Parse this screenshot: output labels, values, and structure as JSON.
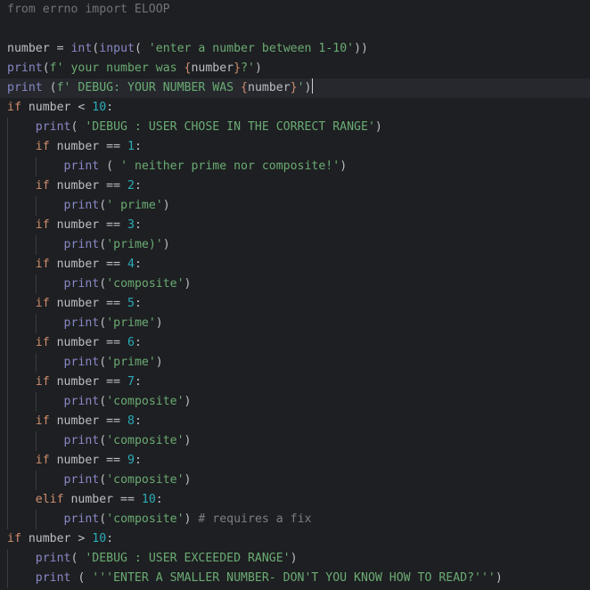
{
  "colors": {
    "background": "#1e1f22",
    "current_line": "#26282e",
    "keyword": "#cf8e6d",
    "builtin": "#8888c6",
    "string": "#6aab73",
    "number": "#2aacb8",
    "comment": "#7a7e85",
    "identifier": "#bcbec4"
  },
  "code_lines": [
    {
      "indent": 0,
      "tokens": [
        [
          "unused",
          "from errno import ELOOP"
        ]
      ]
    },
    {
      "indent": 0,
      "tokens": []
    },
    {
      "indent": 0,
      "tokens": [
        [
          "id",
          "number"
        ],
        [
          "p",
          " = "
        ],
        [
          "bi",
          "int"
        ],
        [
          "p",
          "("
        ],
        [
          "bi",
          "input"
        ],
        [
          "p",
          "( "
        ],
        [
          "str",
          "'enter a number between 1-10'"
        ],
        [
          "p",
          "))"
        ]
      ]
    },
    {
      "indent": 0,
      "tokens": [
        [
          "bi",
          "print"
        ],
        [
          "p",
          "("
        ],
        [
          "str",
          "f' your number was "
        ],
        [
          "brace",
          "{"
        ],
        [
          "id",
          "number"
        ],
        [
          "brace",
          "}"
        ],
        [
          "str",
          "?'"
        ],
        [
          "p",
          ")"
        ]
      ]
    },
    {
      "indent": 0,
      "current": true,
      "caret": true,
      "tokens": [
        [
          "bi",
          "print"
        ],
        [
          "p",
          " "
        ],
        [
          "p",
          "("
        ],
        [
          "str",
          "f' DEBUG: YOUR NUMBER WAS "
        ],
        [
          "brace",
          "{"
        ],
        [
          "id",
          "number"
        ],
        [
          "brace",
          "}"
        ],
        [
          "str",
          "'"
        ],
        [
          "p",
          ")"
        ]
      ]
    },
    {
      "indent": 0,
      "tokens": [
        [
          "kw",
          "if"
        ],
        [
          "p",
          " number < "
        ],
        [
          "num",
          "10"
        ],
        [
          "p",
          ":"
        ]
      ]
    },
    {
      "indent": 1,
      "tokens": [
        [
          "bi",
          "print"
        ],
        [
          "p",
          "( "
        ],
        [
          "str",
          "'DEBUG : USER CHOSE IN THE CORRECT RANGE'"
        ],
        [
          "p",
          ")"
        ]
      ]
    },
    {
      "indent": 1,
      "tokens": [
        [
          "kw",
          "if"
        ],
        [
          "p",
          " number == "
        ],
        [
          "num",
          "1"
        ],
        [
          "p",
          ":"
        ]
      ]
    },
    {
      "indent": 2,
      "tokens": [
        [
          "bi",
          "print"
        ],
        [
          "p",
          " ( "
        ],
        [
          "str",
          "' neither prime nor composite!'"
        ],
        [
          "p",
          ")"
        ]
      ]
    },
    {
      "indent": 1,
      "tokens": [
        [
          "kw",
          "if"
        ],
        [
          "p",
          " number == "
        ],
        [
          "num",
          "2"
        ],
        [
          "p",
          ":"
        ]
      ]
    },
    {
      "indent": 2,
      "tokens": [
        [
          "bi",
          "print"
        ],
        [
          "p",
          "("
        ],
        [
          "str",
          "' prime'"
        ],
        [
          "p",
          ")"
        ]
      ]
    },
    {
      "indent": 1,
      "tokens": [
        [
          "kw",
          "if"
        ],
        [
          "p",
          " number == "
        ],
        [
          "num",
          "3"
        ],
        [
          "p",
          ":"
        ]
      ]
    },
    {
      "indent": 2,
      "tokens": [
        [
          "bi",
          "print"
        ],
        [
          "p",
          "("
        ],
        [
          "str",
          "'prime)'"
        ],
        [
          "p",
          ")"
        ]
      ]
    },
    {
      "indent": 1,
      "tokens": [
        [
          "kw",
          "if"
        ],
        [
          "p",
          " number == "
        ],
        [
          "num",
          "4"
        ],
        [
          "p",
          ":"
        ]
      ]
    },
    {
      "indent": 2,
      "tokens": [
        [
          "bi",
          "print"
        ],
        [
          "p",
          "("
        ],
        [
          "str",
          "'composite'"
        ],
        [
          "p",
          ")"
        ]
      ]
    },
    {
      "indent": 1,
      "tokens": [
        [
          "kw",
          "if"
        ],
        [
          "p",
          " number == "
        ],
        [
          "num",
          "5"
        ],
        [
          "p",
          ":"
        ]
      ]
    },
    {
      "indent": 2,
      "tokens": [
        [
          "bi",
          "print"
        ],
        [
          "p",
          "("
        ],
        [
          "str",
          "'prime'"
        ],
        [
          "p",
          ")"
        ]
      ]
    },
    {
      "indent": 1,
      "tokens": [
        [
          "kw",
          "if"
        ],
        [
          "p",
          " number == "
        ],
        [
          "num",
          "6"
        ],
        [
          "p",
          ":"
        ]
      ]
    },
    {
      "indent": 2,
      "tokens": [
        [
          "bi",
          "print"
        ],
        [
          "p",
          "("
        ],
        [
          "str",
          "'prime'"
        ],
        [
          "p",
          ")"
        ]
      ]
    },
    {
      "indent": 1,
      "tokens": [
        [
          "kw",
          "if"
        ],
        [
          "p",
          " number == "
        ],
        [
          "num",
          "7"
        ],
        [
          "p",
          ":"
        ]
      ]
    },
    {
      "indent": 2,
      "tokens": [
        [
          "bi",
          "print"
        ],
        [
          "p",
          "("
        ],
        [
          "str",
          "'composite'"
        ],
        [
          "p",
          ")"
        ]
      ]
    },
    {
      "indent": 1,
      "tokens": [
        [
          "kw",
          "if"
        ],
        [
          "p",
          " number == "
        ],
        [
          "num",
          "8"
        ],
        [
          "p",
          ":"
        ]
      ]
    },
    {
      "indent": 2,
      "tokens": [
        [
          "bi",
          "print"
        ],
        [
          "p",
          "("
        ],
        [
          "str",
          "'composite'"
        ],
        [
          "p",
          ")"
        ]
      ]
    },
    {
      "indent": 1,
      "tokens": [
        [
          "kw",
          "if"
        ],
        [
          "p",
          " number == "
        ],
        [
          "num",
          "9"
        ],
        [
          "p",
          ":"
        ]
      ]
    },
    {
      "indent": 2,
      "tokens": [
        [
          "bi",
          "print"
        ],
        [
          "p",
          "("
        ],
        [
          "str",
          "'composite'"
        ],
        [
          "p",
          ")"
        ]
      ]
    },
    {
      "indent": 1,
      "tokens": [
        [
          "kw",
          "elif"
        ],
        [
          "p",
          " number == "
        ],
        [
          "num",
          "10"
        ],
        [
          "p",
          ":"
        ]
      ]
    },
    {
      "indent": 2,
      "tokens": [
        [
          "bi",
          "print"
        ],
        [
          "p",
          "("
        ],
        [
          "str",
          "'composite'"
        ],
        [
          "p",
          ") "
        ],
        [
          "com",
          "# requires a fix"
        ]
      ]
    },
    {
      "indent": 0,
      "tokens": [
        [
          "kw",
          "if"
        ],
        [
          "p",
          " number > "
        ],
        [
          "num",
          "10"
        ],
        [
          "p",
          ":"
        ]
      ]
    },
    {
      "indent": 1,
      "tokens": [
        [
          "bi",
          "print"
        ],
        [
          "p",
          "( "
        ],
        [
          "str",
          "'DEBUG : USER EXCEEDED RANGE'"
        ],
        [
          "p",
          ")"
        ]
      ]
    },
    {
      "indent": 1,
      "tokens": [
        [
          "bi",
          "print"
        ],
        [
          "p",
          " ( "
        ],
        [
          "str",
          "'''ENTER A SMALLER NUMBER- DON'T YOU KNOW HOW TO READ?'''"
        ],
        [
          "p",
          ")"
        ]
      ]
    }
  ]
}
